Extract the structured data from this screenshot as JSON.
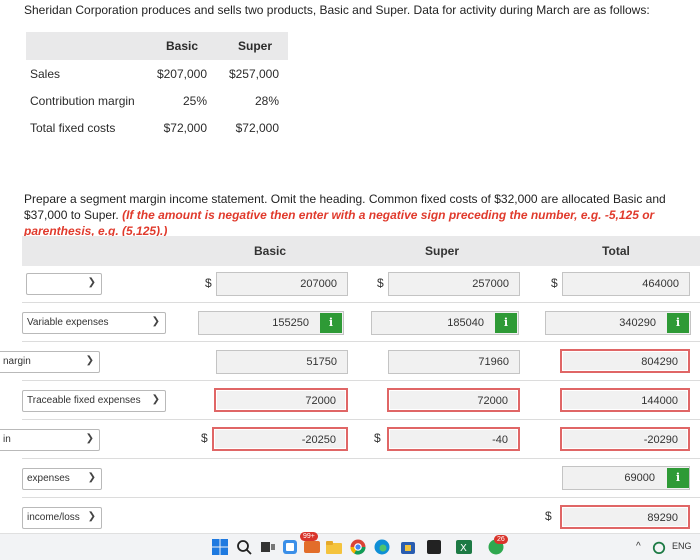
{
  "intro": "Sheridan Corporation produces and sells two products, Basic and Super. Data for activity during March are as follows:",
  "data_table": {
    "columns": [
      "Basic",
      "Super"
    ],
    "rows": [
      {
        "label": "Sales",
        "basic": "$207,000",
        "super": "$257,000"
      },
      {
        "label": "Contribution margin",
        "basic": "25%",
        "super": "28%"
      },
      {
        "label": "Total fixed costs",
        "basic": "$72,000",
        "super": "$72,000"
      }
    ]
  },
  "instructions": {
    "main": "Prepare a segment margin income statement. Omit the heading. Common fixed costs of $32,000 are allocated Basic and $37,000 to Super.",
    "note": "(If the amount is negative then enter with a negative sign preceding the number, e.g. -5,125 or parenthesis, e.g. (5,125).)"
  },
  "statement": {
    "columns": [
      "Basic",
      "Super",
      "Total"
    ],
    "currency": "$",
    "rows": [
      {
        "select": "",
        "basic": "207000",
        "super": "257000",
        "total": "464000"
      },
      {
        "select": "Variable expenses",
        "basic": "155250",
        "super": "185040",
        "total": "340290"
      },
      {
        "select": "nargin",
        "basic": "51750",
        "super": "71960",
        "total": "804290"
      },
      {
        "select": "Traceable fixed expenses",
        "basic": "72000",
        "super": "72000",
        "total": "144000"
      },
      {
        "select": "in",
        "basic": "-20250",
        "super": "-40",
        "total": "-20290"
      },
      {
        "select": "expenses",
        "total": "69000"
      },
      {
        "select": "income/loss",
        "total": "89290"
      }
    ],
    "info_label": "i"
  },
  "taskbar": {
    "badge_mail": "99+",
    "badge_app": "26",
    "lang": "ENG",
    "tray_arrow": "^"
  },
  "colors": {
    "error_border": "#e06666",
    "info_button": "#2e9a36",
    "note_red": "#e03a2c",
    "header_bg": "#e9e9ea"
  }
}
